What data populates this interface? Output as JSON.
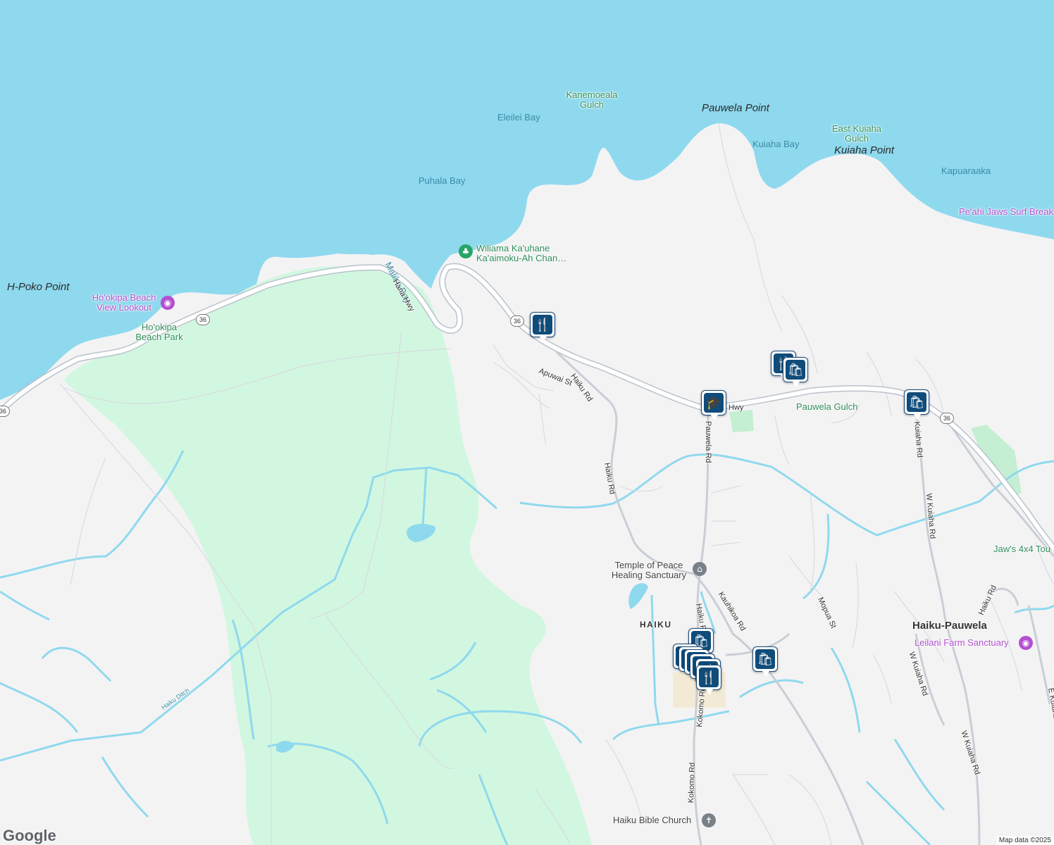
{
  "map": {
    "water_labels": [
      "Eleilei Bay",
      "Puhala Bay",
      "Maliko Bay",
      "Kuiaha Bay",
      "Kapuaraaka"
    ],
    "point_labels": [
      "H-Poko Point",
      "Pauwela Point",
      "Kuiaha Point"
    ],
    "park_labels": [
      "Kanemoeala Gulch",
      "East Kuiaha Gulch",
      "Ho'okipa Beach Park",
      "Pauwela Gulch",
      "Wiliama Ka'uhane Ka'aimoku-Ah Chan…"
    ],
    "poi_labels": [
      "Ho'okipa Beach View Lookout",
      "Pe'ahi Jaws Surf Break",
      "Leilani Farm Sanctuary",
      "Jaw's 4x4 Tou"
    ],
    "place_labels": [
      "Temple of Peace Healing Sanctuary",
      "Haiku Bible Church"
    ],
    "town_labels": [
      "HAIKU",
      "Haiku-Pauwela"
    ],
    "road_labels": [
      "Hana Hwy",
      "Apuwai St",
      "Haiku Rd",
      "Hwy",
      "Pauwela Rd",
      "Haiku Rd",
      "Kauhikoa Rd",
      "Haiku R",
      "Mopua St",
      "W Kuiaha Rd",
      "Kuiaha Rd",
      "Haiku Rd",
      "W Kuiaha Rd",
      "W Kuiaha Rd",
      "E Kuiaha R",
      "Kokomo Rd",
      "Kokomo Rd",
      "Haiku Ditch"
    ],
    "route_shield": "36",
    "pins": [
      {
        "type": "restaurant-icon",
        "glyph": "🍴"
      },
      {
        "type": "restaurant-icon",
        "glyph": "🍴"
      },
      {
        "type": "shopping-bag-icon",
        "glyph": "🛍"
      },
      {
        "type": "school-icon",
        "glyph": "🎓"
      },
      {
        "type": "shopping-bag-icon",
        "glyph": "🛍"
      },
      {
        "type": "shopping-bag-icon",
        "glyph": "🛍"
      },
      {
        "type": "shopping-bag-icon",
        "glyph": "🛍"
      },
      {
        "type": "restaurant-icon",
        "glyph": "🍴"
      }
    ],
    "logo": "Google",
    "attribution": "Map data ©2025",
    "colors": {
      "water": "#8fd9ee",
      "land": "#f4f3f4",
      "park": "#d2f7e0",
      "road": "#ffffff",
      "stream": "#8fd9ee",
      "pin": "#0f4c7a"
    }
  }
}
